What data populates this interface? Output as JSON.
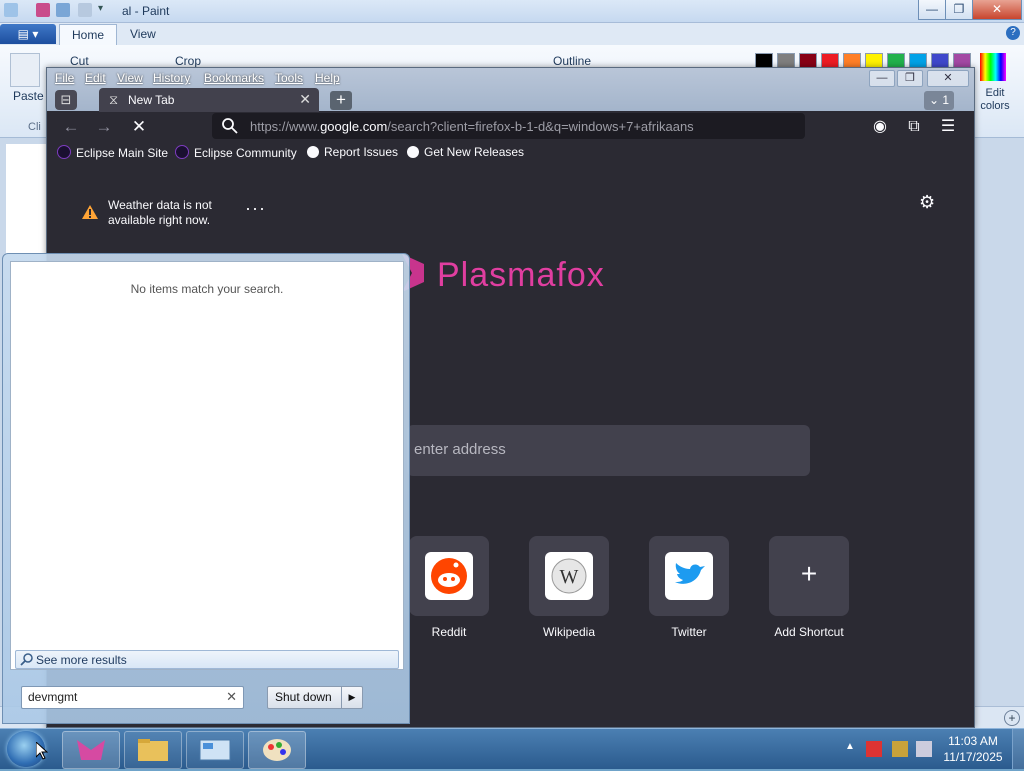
{
  "paint": {
    "title": "al - Paint",
    "tabs": [
      {
        "label": "Home"
      },
      {
        "label": "View"
      }
    ],
    "ribbon": {
      "paste": "Paste",
      "cut": "Cut",
      "crop": "Crop",
      "outline": "Outline",
      "edit_colors": "Edit colors",
      "clipboard_group": "Cli"
    },
    "palette": [
      "#000000",
      "#7f7f7f",
      "#880015",
      "#ed1c24",
      "#ff7f27",
      "#fff200",
      "#22b14c",
      "#00a2e8",
      "#3f48cc",
      "#a349a4"
    ],
    "win_controls": {
      "minimize": "—",
      "maximize": "❐",
      "close": "✕"
    }
  },
  "browser": {
    "menu": [
      "File",
      "Edit",
      "View",
      "History",
      "Bookmarks",
      "Tools",
      "Help"
    ],
    "win_controls": {
      "minimize": "—",
      "restore": "❐",
      "close": "✕"
    },
    "tab": {
      "label": "New Tab",
      "close": "✕"
    },
    "new_tab": "+",
    "tab_count": "1",
    "url": {
      "prefix": "https://www.",
      "domain": "google.com",
      "rest": "/search?client=firefox-b-1-d&q=windows+7+afrikaans"
    },
    "bookmarks": [
      {
        "label": "Eclipse Main Site",
        "icon": "eclipse-icon"
      },
      {
        "label": "Eclipse Community",
        "icon": "eclipse-icon"
      },
      {
        "label": "Report Issues",
        "icon": "github-icon"
      },
      {
        "label": "Get New Releases",
        "icon": "github-icon"
      }
    ],
    "weather": "Weather data is not available right now.",
    "brand": "Plasmafox",
    "search_placeholder": "enter address",
    "shortcuts": [
      {
        "label": "Reddit",
        "icon": "reddit-icon"
      },
      {
        "label": "Wikipedia",
        "icon": "wikipedia-icon"
      },
      {
        "label": "Twitter",
        "icon": "twitter-icon"
      },
      {
        "label": "Add Shortcut",
        "icon": "plus-icon"
      }
    ],
    "brand_color": "#e03ea0"
  },
  "start_menu": {
    "empty_message": "No items match your search.",
    "see_more": "See more results",
    "search_value": "devmgmt",
    "shutdown": "Shut down"
  },
  "taskbar": {
    "time": "11:03 AM",
    "date": "11/17/2025"
  }
}
